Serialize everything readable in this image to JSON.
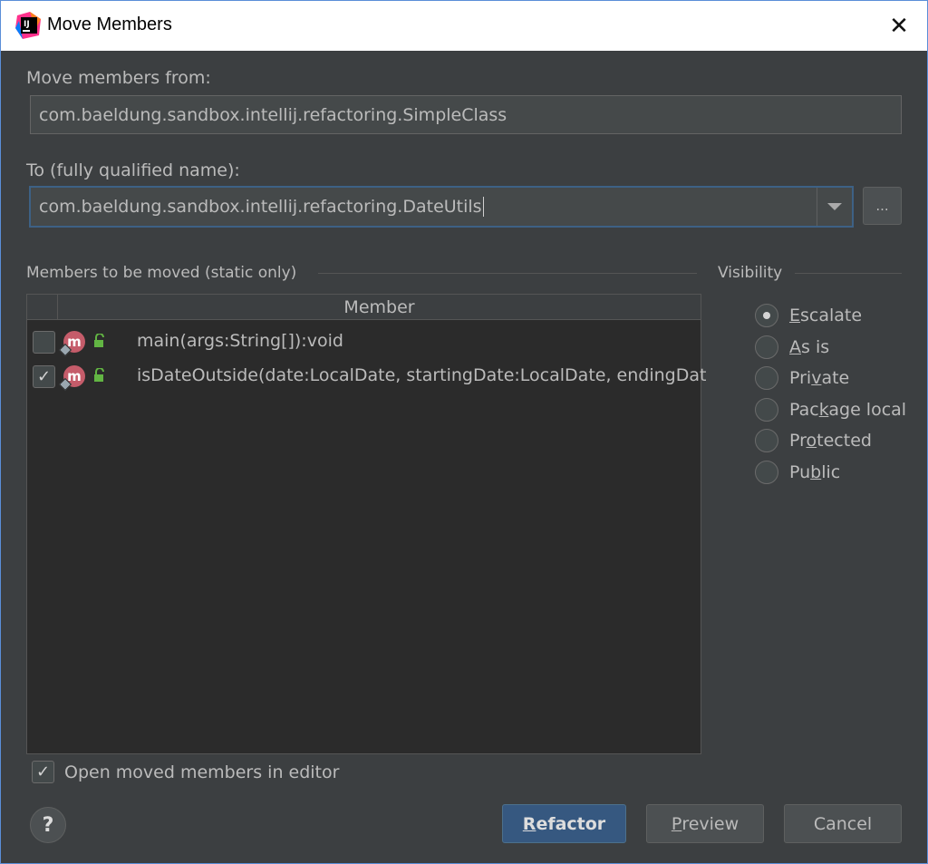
{
  "window": {
    "title": "Move Members",
    "app_icon": "intellij-icon",
    "close_glyph": "✕"
  },
  "from": {
    "label": "Move members from:",
    "value": "com.baeldung.sandbox.intellij.refactoring.SimpleClass"
  },
  "to": {
    "label": "To (fully qualified name):",
    "value": "com.baeldung.sandbox.intellij.refactoring.DateUtils",
    "browse_label": "..."
  },
  "members": {
    "section_label": "Members to be moved (static only)",
    "column_header": "Member",
    "rows": [
      {
        "checked": false,
        "text": "main(args:String[]):void"
      },
      {
        "checked": true,
        "text": "isDateOutside(date:LocalDate, startingDate:LocalDate, endingDat"
      }
    ]
  },
  "visibility": {
    "section_label": "Visibility",
    "options": [
      {
        "pre": "",
        "mn": "E",
        "post": "scalate",
        "selected": true
      },
      {
        "pre": "",
        "mn": "A",
        "post": "s is",
        "selected": false
      },
      {
        "pre": "Pri",
        "mn": "v",
        "post": "ate",
        "selected": false
      },
      {
        "pre": "Pac",
        "mn": "k",
        "post": "age local",
        "selected": false
      },
      {
        "pre": "Pr",
        "mn": "o",
        "post": "tected",
        "selected": false
      },
      {
        "pre": "Pu",
        "mn": "b",
        "post": "lic",
        "selected": false
      }
    ]
  },
  "open_in_editor": {
    "checked": true,
    "label": "Open moved members in editor"
  },
  "buttons": {
    "help": "?",
    "refactor": {
      "mn": "R",
      "rest": "efactor"
    },
    "preview": {
      "mn": "P",
      "rest": "review"
    },
    "cancel": "Cancel"
  },
  "colors": {
    "background": "#3c3f41",
    "table_bg": "#2b2b2b",
    "primary_button": "#365880",
    "method_icon": "#c55c6a",
    "lock_icon": "#62b543"
  }
}
